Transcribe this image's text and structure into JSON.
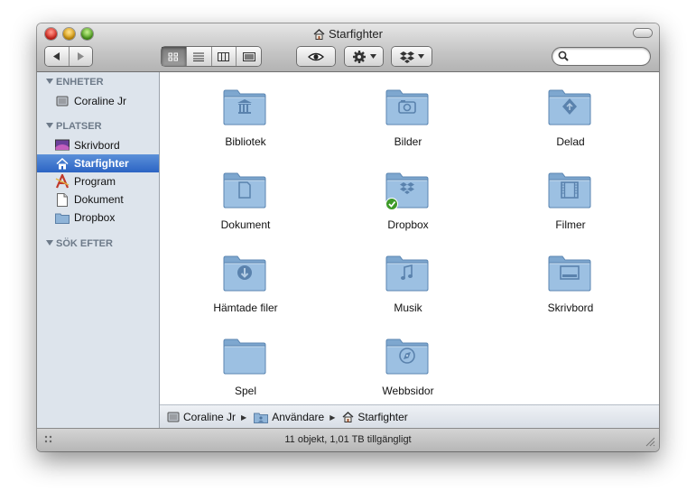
{
  "window": {
    "title": "Starfighter"
  },
  "toolbar": {
    "view_modes": [
      "icon-view",
      "list-view",
      "column-view",
      "coverflow-view"
    ],
    "selected_view": "icon-view",
    "search": {
      "value": "",
      "placeholder": ""
    }
  },
  "sidebar": {
    "sections": [
      {
        "label": "ENHETER"
      },
      {
        "label": "PLATSER"
      },
      {
        "label": "SÖK EFTER"
      }
    ],
    "devices": [
      {
        "label": "Coraline Jr",
        "icon": "hard-drive-icon"
      }
    ],
    "places": [
      {
        "label": "Skrivbord",
        "icon": "desktop-icon"
      },
      {
        "label": "Starfighter",
        "icon": "home-icon",
        "selected": true
      },
      {
        "label": "Program",
        "icon": "applications-icon"
      },
      {
        "label": "Dokument",
        "icon": "document-icon"
      },
      {
        "label": "Dropbox",
        "icon": "folder-icon"
      }
    ]
  },
  "items": [
    {
      "label": "Bibliotek",
      "icon": "library-folder-icon"
    },
    {
      "label": "Bilder",
      "icon": "pictures-folder-icon"
    },
    {
      "label": "Delad",
      "icon": "shared-folder-icon"
    },
    {
      "label": "Dokument",
      "icon": "documents-folder-icon"
    },
    {
      "label": "Dropbox",
      "icon": "dropbox-folder-icon",
      "badge": "synced-check"
    },
    {
      "label": "Filmer",
      "icon": "movies-folder-icon"
    },
    {
      "label": "Hämtade filer",
      "icon": "downloads-folder-icon"
    },
    {
      "label": "Musik",
      "icon": "music-folder-icon"
    },
    {
      "label": "Skrivbord",
      "icon": "desktop-folder-icon"
    },
    {
      "label": "Spel",
      "icon": "plain-folder-icon"
    },
    {
      "label": "Webbsidor",
      "icon": "sites-folder-icon"
    }
  ],
  "pathbar": [
    {
      "label": "Coraline Jr",
      "icon": "hard-drive-icon"
    },
    {
      "label": "Användare",
      "icon": "users-folder-icon"
    },
    {
      "label": "Starfighter",
      "icon": "home-icon"
    }
  ],
  "status": {
    "text": "11 objekt, 1,01 TB tillgängligt"
  },
  "colors": {
    "selection": "#3a72cf",
    "sidebar_bg": "#dde4ec",
    "folder": "#8fb4d8"
  }
}
